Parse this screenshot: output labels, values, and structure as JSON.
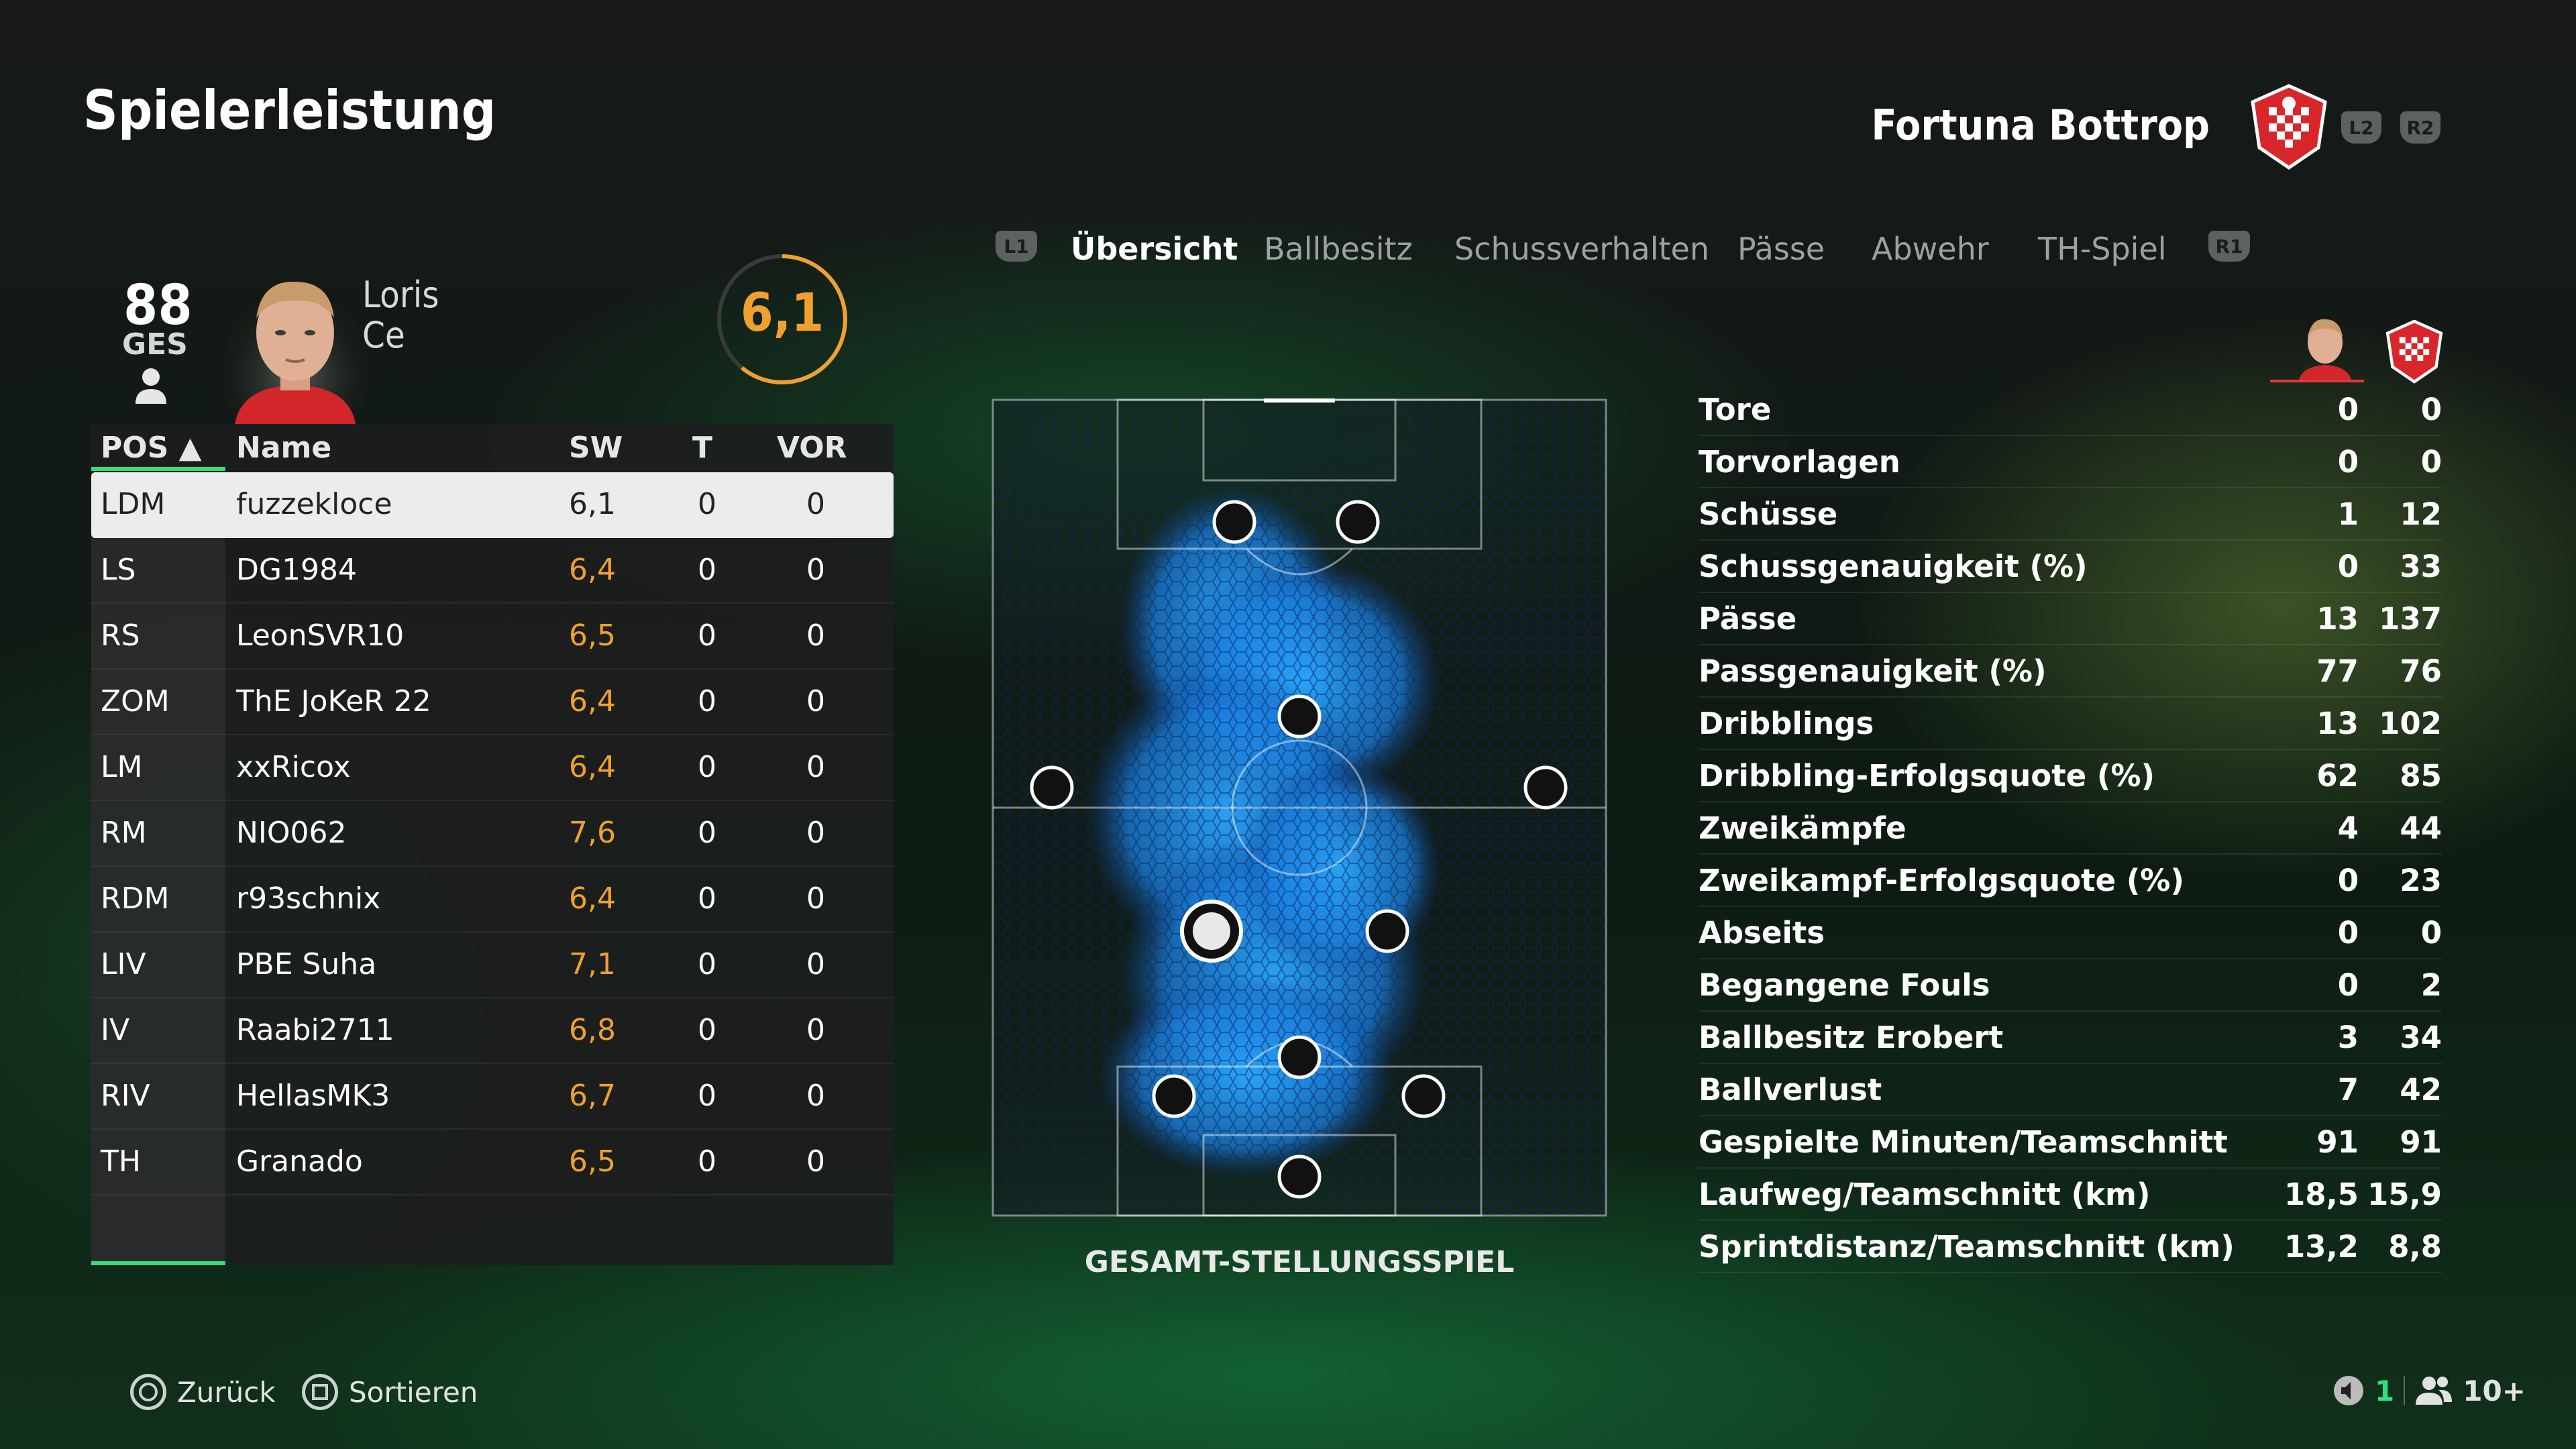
{
  "header": {
    "title": "Spielerleistung",
    "team_name": "Fortuna Bottrop",
    "buttons": [
      "L2",
      "R2"
    ]
  },
  "player": {
    "ovr": "88",
    "ovr_label": "GES",
    "first_name": "Loris",
    "last_name": "Ce",
    "rating": "6,1",
    "rating_fill": 0.61
  },
  "table": {
    "columns": [
      "POS ▲",
      "Name",
      "SW",
      "T",
      "VOR"
    ],
    "rows": [
      {
        "pos": "LDM",
        "name": "fuzzekloce",
        "sw": "6,1",
        "t": "0",
        "vor": "0"
      },
      {
        "pos": "LS",
        "name": "DG1984",
        "sw": "6,4",
        "t": "0",
        "vor": "0"
      },
      {
        "pos": "RS",
        "name": "LeonSVR10",
        "sw": "6,5",
        "t": "0",
        "vor": "0"
      },
      {
        "pos": "ZOM",
        "name": "ThE JoKeR 22",
        "sw": "6,4",
        "t": "0",
        "vor": "0"
      },
      {
        "pos": "LM",
        "name": "xxRicox",
        "sw": "6,4",
        "t": "0",
        "vor": "0"
      },
      {
        "pos": "RM",
        "name": "NIO062",
        "sw": "7,6",
        "t": "0",
        "vor": "0"
      },
      {
        "pos": "RDM",
        "name": "r93schnix",
        "sw": "6,4",
        "t": "0",
        "vor": "0"
      },
      {
        "pos": "LIV",
        "name": "PBE Suha",
        "sw": "7,1",
        "t": "0",
        "vor": "0"
      },
      {
        "pos": "IV",
        "name": "Raabi2711",
        "sw": "6,8",
        "t": "0",
        "vor": "0"
      },
      {
        "pos": "RIV",
        "name": "HellasMK3",
        "sw": "6,7",
        "t": "0",
        "vor": "0"
      },
      {
        "pos": "TH",
        "name": "Granado",
        "sw": "6,5",
        "t": "0",
        "vor": "0"
      }
    ]
  },
  "tabs": {
    "left_button": "L1",
    "right_button": "R1",
    "items": [
      "Übersicht",
      "Ballbesitz",
      "Schussverhalten",
      "Pässe",
      "Abwehr",
      "TH-Spiel"
    ],
    "active": "Übersicht"
  },
  "pitch": {
    "caption": "GESAMT-STELLUNGSSPIEL"
  },
  "stats": [
    {
      "label": "Tore",
      "player": "0",
      "team": "0"
    },
    {
      "label": "Torvorlagen",
      "player": "0",
      "team": "0"
    },
    {
      "label": "Schüsse",
      "player": "1",
      "team": "12"
    },
    {
      "label": "Schussgenauigkeit (%)",
      "player": "0",
      "team": "33"
    },
    {
      "label": "Pässe",
      "player": "13",
      "team": "137"
    },
    {
      "label": "Passgenauigkeit (%)",
      "player": "77",
      "team": "76"
    },
    {
      "label": "Dribblings",
      "player": "13",
      "team": "102"
    },
    {
      "label": "Dribbling-Erfolgsquote (%)",
      "player": "62",
      "team": "85"
    },
    {
      "label": "Zweikämpfe",
      "player": "4",
      "team": "44"
    },
    {
      "label": "Zweikampf-Erfolgsquote (%)",
      "player": "0",
      "team": "23"
    },
    {
      "label": "Abseits",
      "player": "0",
      "team": "0"
    },
    {
      "label": "Begangene Fouls",
      "player": "0",
      "team": "2"
    },
    {
      "label": "Ballbesitz Erobert",
      "player": "3",
      "team": "34"
    },
    {
      "label": "Ballverlust",
      "player": "7",
      "team": "42"
    },
    {
      "label": "Gespielte Minuten/Teamschnitt",
      "player": "91",
      "team": "91"
    },
    {
      "label": "Laufweg/Teamschnitt (km)",
      "player": "18,5",
      "team": "15,9"
    },
    {
      "label": "Sprintdistanz/Teamschnitt (km)",
      "player": "13,2",
      "team": "8,8"
    }
  ],
  "footer": {
    "back_label": "Zurück",
    "sort_label": "Sortieren",
    "speaker_count": "1",
    "players_count": "10+"
  },
  "colors": {
    "accent_green": "#2fdf7b",
    "rating_orange": "#f0a030",
    "heat_blue": "#1f8fff",
    "crest_red": "#d9262b"
  }
}
